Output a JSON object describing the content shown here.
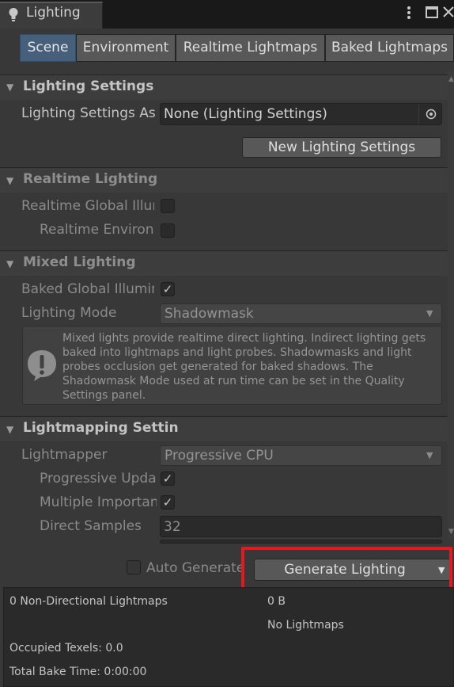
{
  "window": {
    "title": "Lighting",
    "menu_icon": "kebab-menu-icon",
    "maximize_icon": "maximize-icon",
    "close_icon": "close-icon"
  },
  "tabs": [
    "Scene",
    "Environment",
    "Realtime Lightmaps",
    "Baked Lightmaps"
  ],
  "lighting_settings": {
    "header": "Lighting Settings",
    "asset_label": "Lighting Settings Asset",
    "asset_value": "None (Lighting Settings)",
    "new_button": "New Lighting Settings"
  },
  "realtime_lighting": {
    "header": "Realtime Lighting",
    "gi_label": "Realtime Global Illumination",
    "env_label": "Realtime Environment Lighting"
  },
  "mixed_lighting": {
    "header": "Mixed Lighting",
    "baked_gi_label": "Baked Global Illumination",
    "baked_gi_checked": true,
    "mode_label": "Lighting Mode",
    "mode_value": "Shadowmask",
    "help_text": "Mixed lights provide realtime direct lighting. Indirect lighting gets baked into lightmaps and light probes. Shadowmasks and light probes occlusion get generated for baked shadows. The Shadowmask Mode used at run time can be set in the Quality Settings panel."
  },
  "lightmapping": {
    "header": "Lightmapping Settings",
    "lightmapper_label": "Lightmapper",
    "lightmapper_value": "Progressive CPU",
    "progressive_updates_label": "Progressive Updates",
    "importance_label": "Multiple Importance Sampling",
    "direct_samples_label": "Direct Samples",
    "direct_samples_value": "32"
  },
  "footer": {
    "auto_generate_label": "Auto Generate",
    "generate_button": "Generate Lighting"
  },
  "stats": {
    "lightmaps_label": "0 Non-Directional Lightmaps",
    "size": "0 B",
    "no_lightmaps": "No Lightmaps",
    "occupied_texels": "Occupied Texels: 0.0",
    "total_bake_time": "Total Bake Time: 0:00:00"
  },
  "colors": {
    "highlight": "#e3191f",
    "active_tab": "#46607c"
  }
}
